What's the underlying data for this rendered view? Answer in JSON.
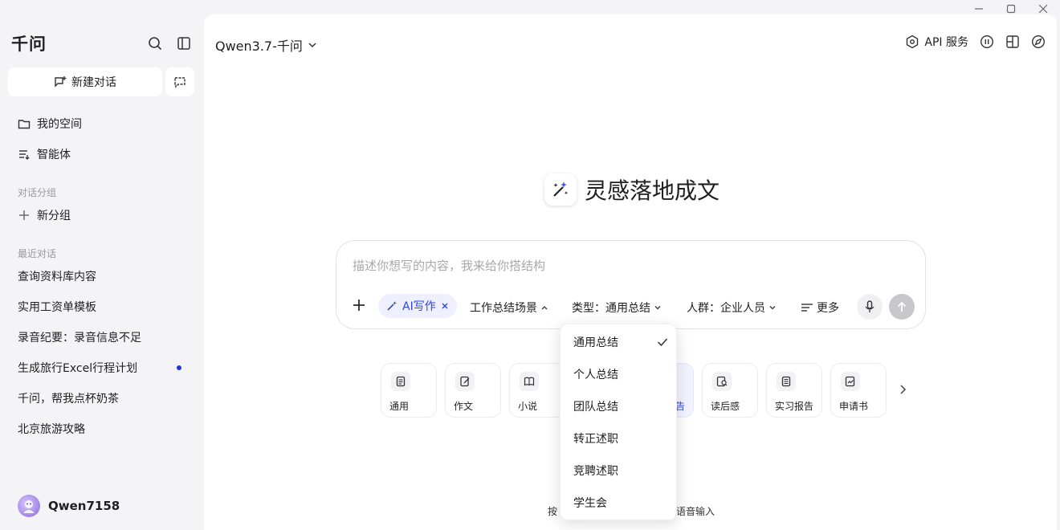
{
  "window": {
    "controls": [
      "minimize",
      "maximize",
      "close"
    ]
  },
  "sidebar": {
    "brand": "千问",
    "new_chat": "新建对话",
    "nav": [
      {
        "label": "我的空间",
        "icon": "folder-icon"
      },
      {
        "label": "智能体",
        "icon": "agent-list-icon"
      }
    ],
    "groups_label": "对话分组",
    "new_group": "新分组",
    "recent_label": "最近对话",
    "recent": [
      {
        "title": "查询资料库内容",
        "unread": false
      },
      {
        "title": "实用工资单模板",
        "unread": false
      },
      {
        "title": "录音纪要：录音信息不足",
        "unread": false
      },
      {
        "title": "生成旅行Excel行程计划",
        "unread": true
      },
      {
        "title": "千问，帮我点杯奶茶",
        "unread": false
      },
      {
        "title": "北京旅游攻略",
        "unread": false
      }
    ],
    "user": {
      "name": "Qwen7158"
    }
  },
  "header": {
    "model": "Qwen3.7-千问",
    "api_service": "API 服务"
  },
  "hero": {
    "title": "灵感落地成文"
  },
  "composer": {
    "placeholder": "描述你想写的内容，我来给你搭结构",
    "chip": "AI写作",
    "scene": "工作总结场景",
    "type": "类型：通用总结",
    "audience": "人群：企业人员",
    "more": "更多"
  },
  "cards": [
    {
      "label": "通用",
      "icon": "document-icon"
    },
    {
      "label": "作文",
      "icon": "edit-doc-icon"
    },
    {
      "label": "小说",
      "icon": "book-icon"
    },
    {
      "label": "告",
      "icon": "report-icon",
      "active": true
    },
    {
      "label": "读后感",
      "icon": "reading-icon"
    },
    {
      "label": "实习报告",
      "icon": "report-doc-icon"
    },
    {
      "label": "申请书",
      "icon": "application-icon"
    }
  ],
  "hint": {
    "left": "按",
    "right": "语音输入"
  },
  "dropdown": {
    "options": [
      "通用总结",
      "个人总结",
      "团队总结",
      "转正述职",
      "竞聘述职",
      "学生会"
    ],
    "selected_index": 0
  }
}
